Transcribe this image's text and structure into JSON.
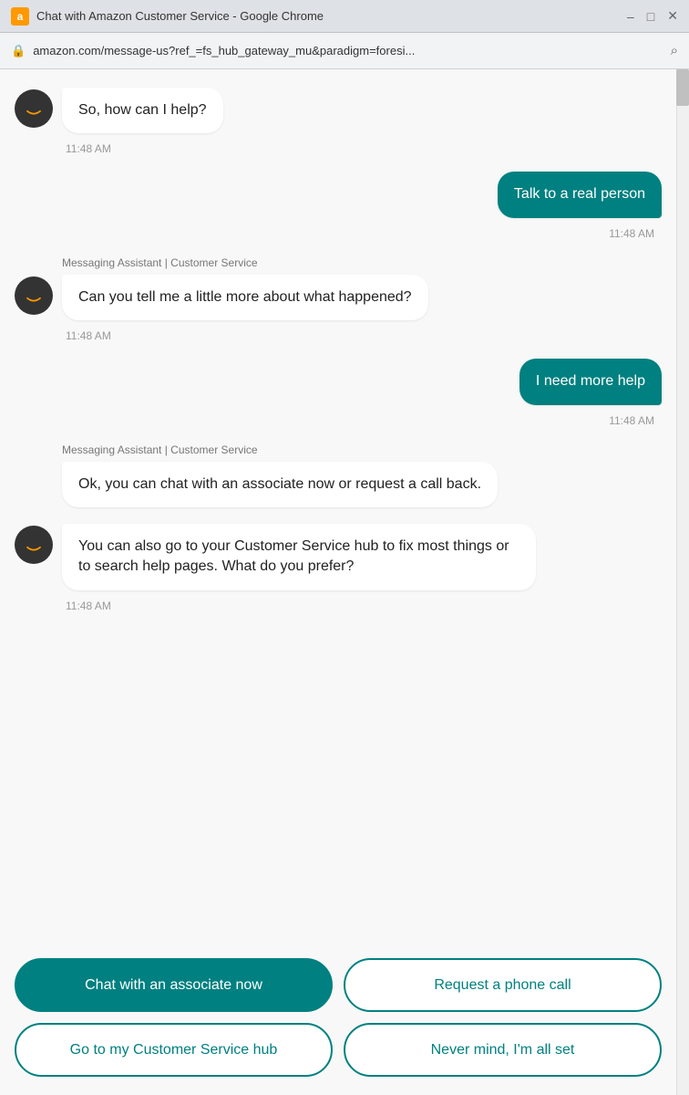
{
  "window": {
    "title": "Chat with Amazon Customer Service - Google Chrome",
    "icon_label": "a",
    "address": "amazon.com/message-us?ref_=fs_hub_gateway_mu&paradigm=foresi...",
    "controls": [
      "–",
      "□",
      "✕"
    ]
  },
  "chat": {
    "sender_label": "Messaging Assistant | Customer Service",
    "messages": [
      {
        "id": "msg1",
        "type": "bot",
        "text": "So, how can I help?",
        "time": "11:48 AM",
        "show_avatar": true
      },
      {
        "id": "msg2",
        "type": "user",
        "text": "Talk to a real person",
        "time": "11:48 AM"
      },
      {
        "id": "msg3",
        "type": "bot",
        "text": "Can you tell me a little more about what happened?",
        "time": "11:48 AM",
        "show_avatar": true
      },
      {
        "id": "msg4",
        "type": "user",
        "text": "I need more help",
        "time": "11:48 AM"
      },
      {
        "id": "msg5",
        "type": "bot",
        "text": "Ok, you can chat with an associate now or request a call back.",
        "time": null,
        "show_avatar": false
      },
      {
        "id": "msg6",
        "type": "bot",
        "text": "You can also go to your Customer Service hub to fix most things or to search help pages. What do you prefer?",
        "time": "11:48 AM",
        "show_avatar": true
      }
    ],
    "buttons": [
      {
        "id": "btn_chat",
        "label": "Chat with an associate now",
        "style": "filled"
      },
      {
        "id": "btn_phone",
        "label": "Request a phone call",
        "style": "outline"
      },
      {
        "id": "btn_hub",
        "label": "Go to my Customer Service hub",
        "style": "outline"
      },
      {
        "id": "btn_nevermind",
        "label": "Never mind, I'm all set",
        "style": "outline"
      }
    ]
  },
  "colors": {
    "teal": "#007d7d",
    "teal_light": "#008888"
  }
}
